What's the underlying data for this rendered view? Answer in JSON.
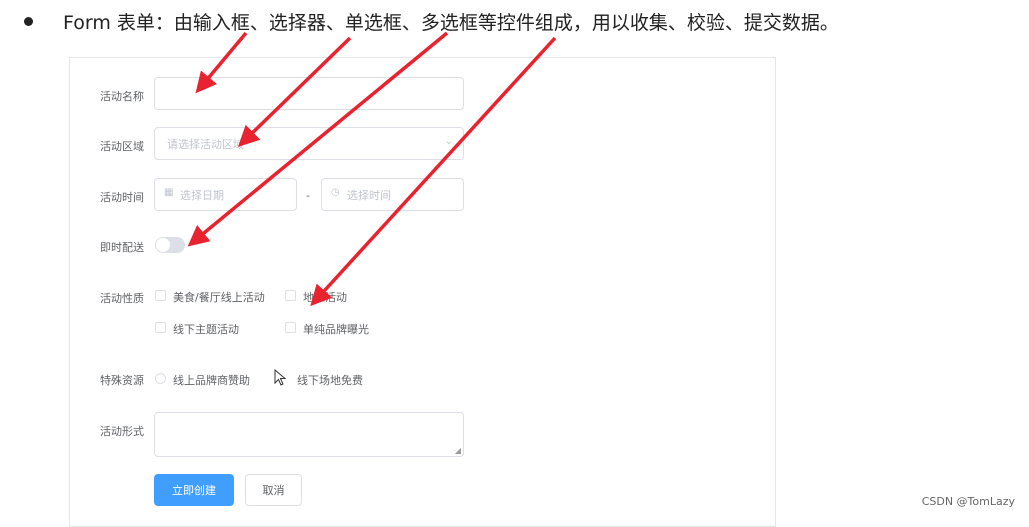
{
  "heading": "Form 表单：由输入框、选择器、单选框、多选框等控件组成，用以收集、校验、提交数据。",
  "form": {
    "name_label": "活动名称",
    "name_value": "",
    "region_label": "活动区域",
    "region_placeholder": "请选择活动区域",
    "time_label": "活动时间",
    "date_placeholder": "选择日期",
    "time_separator": "-",
    "time_placeholder": "选择时间",
    "delivery_label": "即时配送",
    "delivery_on": false,
    "type_label": "活动性质",
    "type_options": [
      "美食/餐厅线上活动",
      "地推活动",
      "线下主题活动",
      "单纯品牌曝光"
    ],
    "resource_label": "特殊资源",
    "resource_options": [
      "线上品牌商赞助",
      "线下场地免费"
    ],
    "desc_label": "活动形式",
    "desc_value": "",
    "submit_label": "立即创建",
    "cancel_label": "取消"
  },
  "icons": {
    "region": "chevron-down-icon",
    "date": "calendar-icon",
    "time": "clock-icon",
    "resize": "resize-handle-icon",
    "cursor": "mouse-pointer-icon"
  },
  "colors": {
    "primary": "#409eff",
    "arrow": "#e8232f",
    "border": "#dcdfe6"
  },
  "watermark": "CSDN @TomLazy"
}
